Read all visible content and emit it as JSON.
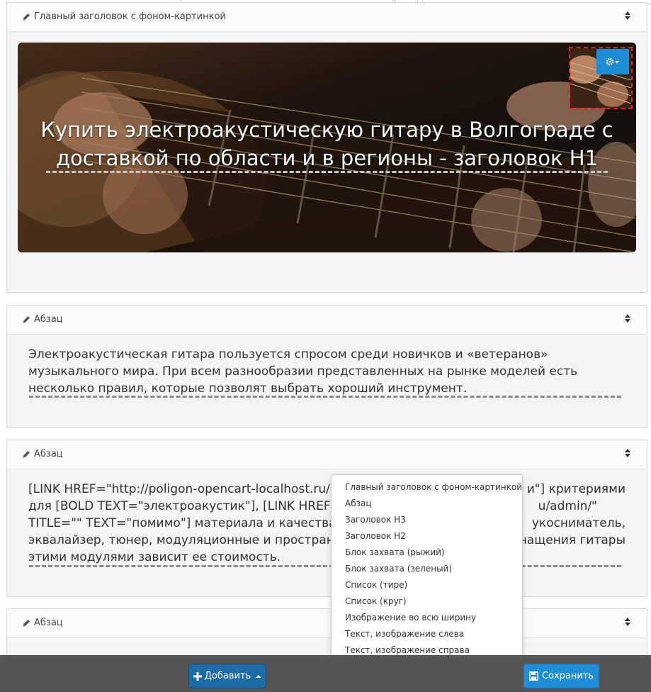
{
  "panels": [
    {
      "title": "Главный заголовок с фоном-картинкой",
      "hero_title": "Купить электроакустическую гитару в Волгограде с доставкой по области и в регионы - заголовок H1"
    },
    {
      "title": "Абзац",
      "text": "Электроакустическая гитара пользуется спросом среди новичков и «ветеранов» музыкального мира. При всем разнообразии представленных на рынке моделей есть несколько правил, которые позволят выбрать хороший инструмент."
    },
    {
      "title": "Абзац",
      "line1a": "[LINK HREF=\"http://poligon-opencart-localhost.ru/ad",
      "line1b": "и\"] критериями",
      "line2a": "для [BOLD TEXT=\"электроакустик\"], [LINK HREF=\"ht",
      "line2b": "u/admin/\"",
      "line3a": "TITLE=\"\" TEXT=\"помимо\"] материала и качества сб",
      "line3b": "укосниматель,",
      "line4a": "эквалайзер, тюнер, модуляционные и пространств",
      "line4b": "нащения гитары",
      "line5a": "этими модулями зависит ее стоимость."
    },
    {
      "title": "Абзац"
    }
  ],
  "dropdown": {
    "items": [
      "Главный заголовок с фоном-картинкой",
      "Абзац",
      "Заголовок H3",
      "Заголовок H2",
      "Блок захвата (рыжий)",
      "Блок захвата (зеленый)",
      "Список (тире)",
      "Список (круг)",
      "Изображение во всю ширину",
      "Текст, изображение слева",
      "Текст, изображение справа"
    ]
  },
  "toolbar": {
    "add_label": "Добавить",
    "save_label": "Сохранить"
  },
  "colors": {
    "primary": "#1f8dd6",
    "add_button": "#1b6ba6",
    "bottom_bar": "#555555",
    "thumb_border": "#e0201b"
  },
  "icons": [
    "pencil-icon",
    "sort-icon",
    "gear-icon",
    "plus-icon",
    "save-icon"
  ]
}
